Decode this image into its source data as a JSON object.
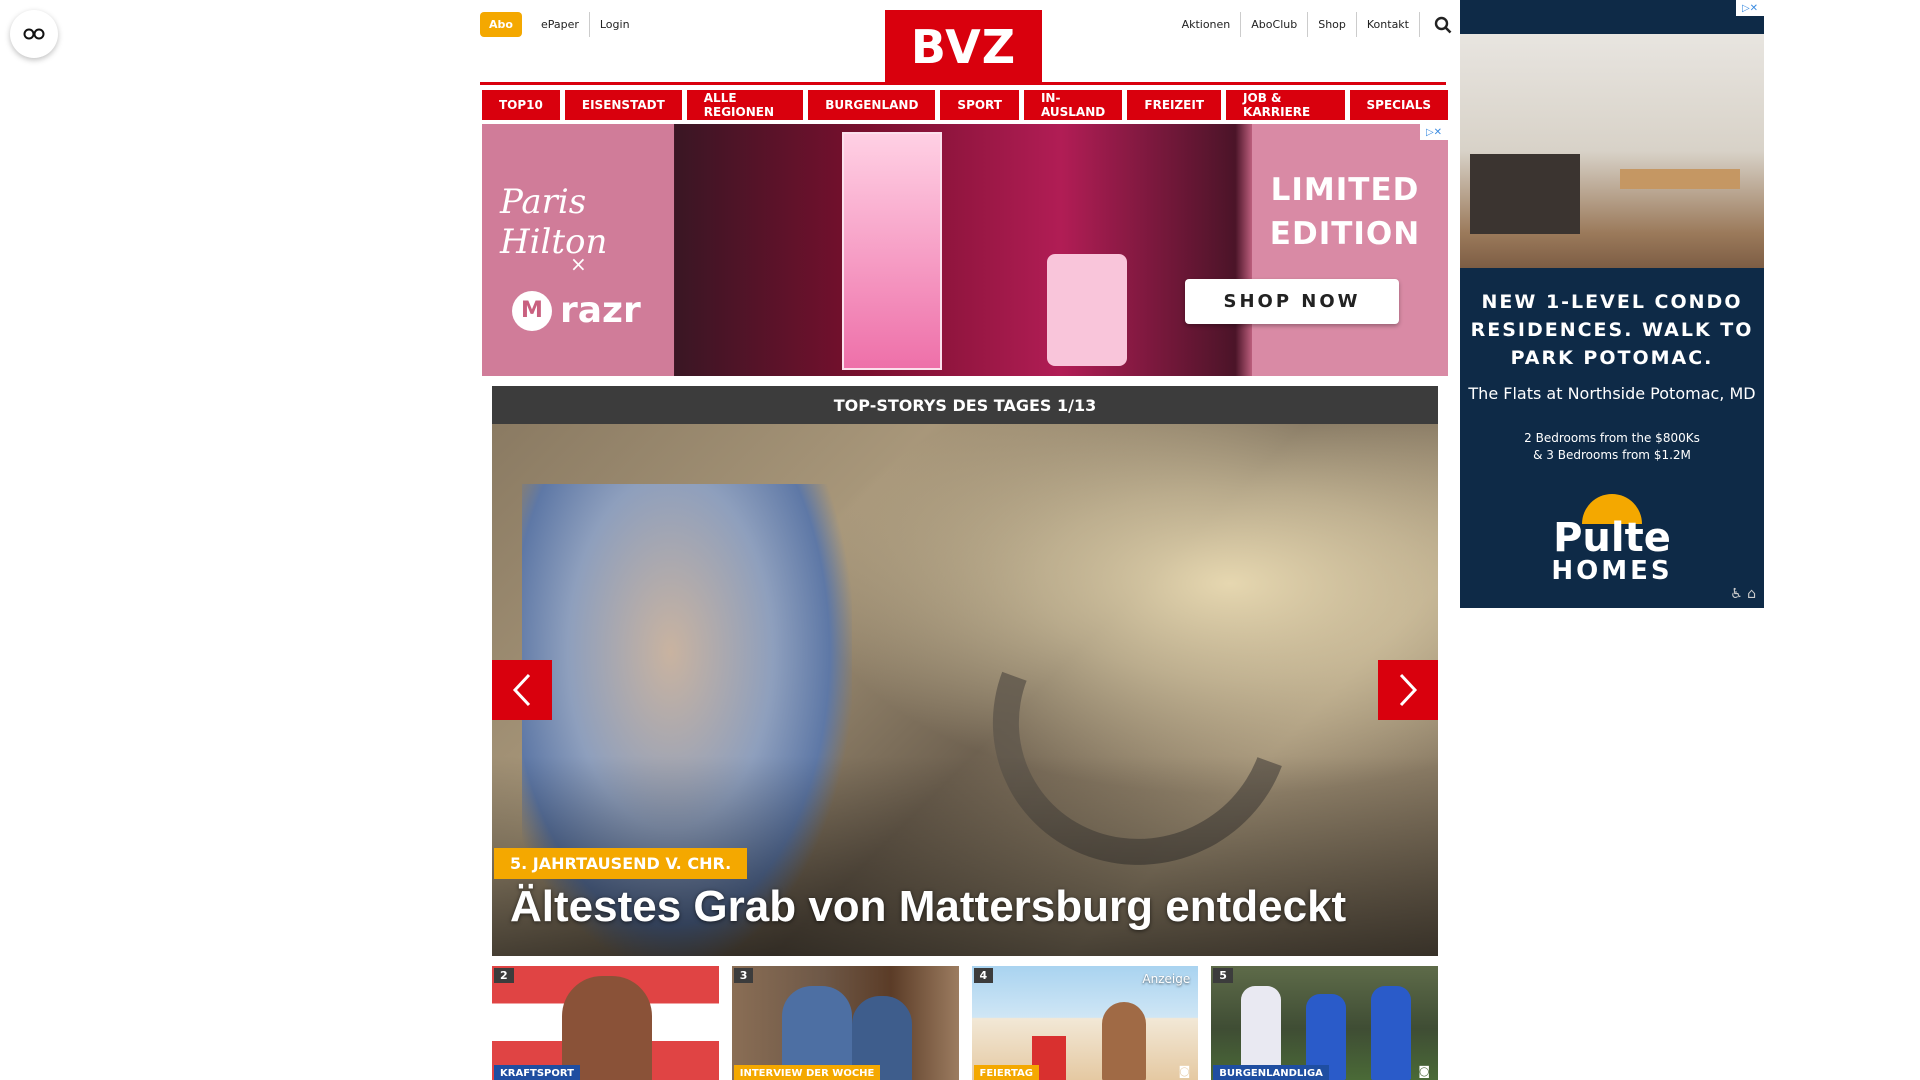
{
  "header": {
    "abo": "Abo",
    "left_links": [
      "ePaper",
      "Login"
    ],
    "logo": "BVZ",
    "right_links": [
      "Aktionen",
      "AboClub",
      "Shop",
      "Kontakt"
    ]
  },
  "nav": [
    "TOP10",
    "EISENSTADT",
    "ALLE REGIONEN",
    "BURGENLAND",
    "SPORT",
    "IN-AUSLAND",
    "FREIZEIT",
    "JOB & KARRIERE",
    "SPECIALS"
  ],
  "banner_ad": {
    "brand1": "Paris Hilton",
    "separator": "×",
    "brand2": "razr",
    "headline": "LIMITED EDITION",
    "cta": "SHOP NOW"
  },
  "top_stories": {
    "header": "TOP-STORYS DES TAGES 1/13",
    "hero": {
      "kicker": "5. JAHRTAUSEND V. CHR.",
      "title": "Ältestes Grab von Mattersburg entdeckt"
    },
    "thumbs": [
      {
        "num": "2",
        "tag": "KRAFTSPORT"
      },
      {
        "num": "3",
        "tag": "INTERVIEW DER WOCHE"
      },
      {
        "num": "4",
        "tag": "FEIERTAG",
        "badge": "Anzeige"
      },
      {
        "num": "5",
        "tag": "BURGENLANDLIGA"
      }
    ]
  },
  "sky_ad": {
    "headline": "NEW 1-LEVEL CONDO RESIDENCES. WALK TO PARK POTOMAC.",
    "name": "The Flats at Northside Potomac, MD",
    "prices_line1": "2 Bedrooms from the $800Ks",
    "prices_line2": "& 3 Bedrooms from $1.2M",
    "logo_line1": "Pulte",
    "logo_line2": "HOMES"
  },
  "colors": {
    "brand_red": "#d9000d",
    "accent_yellow": "#f4a800",
    "dark_header": "#3c3c3c",
    "ad_navy": "#0e2a47"
  }
}
